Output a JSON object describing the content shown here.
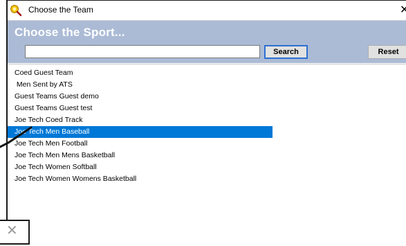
{
  "window": {
    "title": "Choose the Team",
    "close_glyph": "✕"
  },
  "header": {
    "heading": "Choose the Sport..."
  },
  "search": {
    "value": "",
    "placeholder": "",
    "search_label": "Search",
    "reset_label": "Reset"
  },
  "teams": {
    "items": [
      {
        "label": "Coed Guest Team"
      },
      {
        "label": " Men Sent by ATS"
      },
      {
        "label": "Guest Teams Guest demo"
      },
      {
        "label": "Guest Teams Guest test"
      },
      {
        "label": "Joe Tech Coed Track"
      },
      {
        "label": "Joe Tech Men Baseball"
      },
      {
        "label": "Joe Tech Men Football"
      },
      {
        "label": "Joe Tech Men Mens Basketball"
      },
      {
        "label": "Joe Tech Women Softball"
      },
      {
        "label": "Joe Tech Women Womens Basketball"
      }
    ],
    "selected": "Joe Tech Men Baseball"
  },
  "popup": {
    "close_glyph": "✕"
  },
  "colors": {
    "header_band": "#abbbd6",
    "selection": "#0078d7",
    "search_border": "#2d6fd1"
  },
  "icons": [
    "app-icon",
    "close-icon",
    "popup-close-icon"
  ]
}
